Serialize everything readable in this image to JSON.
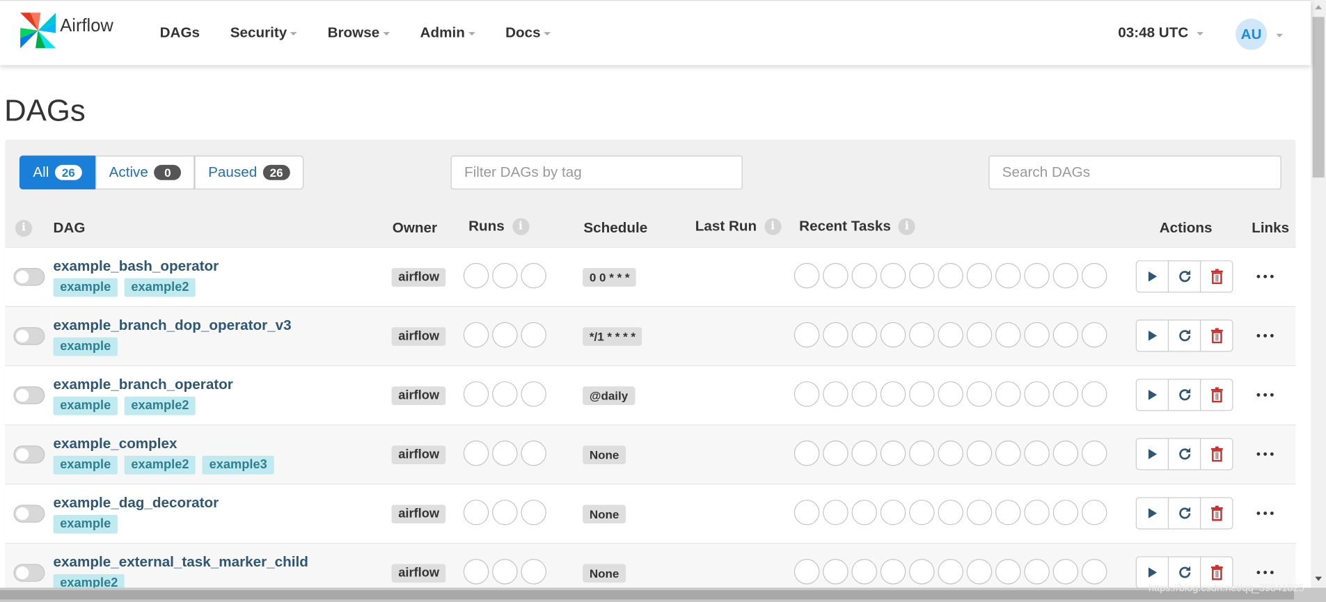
{
  "nav": {
    "brand": "Airflow",
    "items": [
      "DAGs",
      "Security",
      "Browse",
      "Admin",
      "Docs"
    ],
    "time": "03:48 UTC",
    "avatar": "AU"
  },
  "page": {
    "title": "DAGs"
  },
  "status_tabs": [
    {
      "label": "All",
      "count": "26",
      "active": true
    },
    {
      "label": "Active",
      "count": "0",
      "active": false
    },
    {
      "label": "Paused",
      "count": "26",
      "active": false
    }
  ],
  "filter": {
    "tag_placeholder": "Filter DAGs by tag",
    "search_placeholder": "Search DAGs"
  },
  "table": {
    "headers": {
      "dag": "DAG",
      "owner": "Owner",
      "runs": "Runs",
      "schedule": "Schedule",
      "last_run": "Last Run",
      "recent_tasks": "Recent Tasks",
      "actions": "Actions",
      "links": "Links"
    },
    "rows": [
      {
        "name": "example_bash_operator",
        "tags": [
          "example",
          "example2"
        ],
        "owner": "airflow",
        "schedule": "0 0 * * *"
      },
      {
        "name": "example_branch_dop_operator_v3",
        "tags": [
          "example"
        ],
        "owner": "airflow",
        "schedule": "*/1 * * * *"
      },
      {
        "name": "example_branch_operator",
        "tags": [
          "example",
          "example2"
        ],
        "owner": "airflow",
        "schedule": "@daily"
      },
      {
        "name": "example_complex",
        "tags": [
          "example",
          "example2",
          "example3"
        ],
        "owner": "airflow",
        "schedule": "None"
      },
      {
        "name": "example_dag_decorator",
        "tags": [
          "example"
        ],
        "owner": "airflow",
        "schedule": "None"
      },
      {
        "name": "example_external_task_marker_child",
        "tags": [
          "example2"
        ],
        "owner": "airflow",
        "schedule": "None"
      }
    ]
  },
  "watermark": "https://blog.csdn.net/qq_39841825",
  "colors": {
    "accent": "#1a7fd8",
    "dag_link": "#2d5677",
    "tag_bg": "#c0eaf0",
    "delete": "#c9302c"
  },
  "icons": {
    "trigger": "play-icon",
    "refresh": "refresh-icon",
    "delete": "trash-icon",
    "links": "ellipsis-icon",
    "info": "info-icon"
  }
}
